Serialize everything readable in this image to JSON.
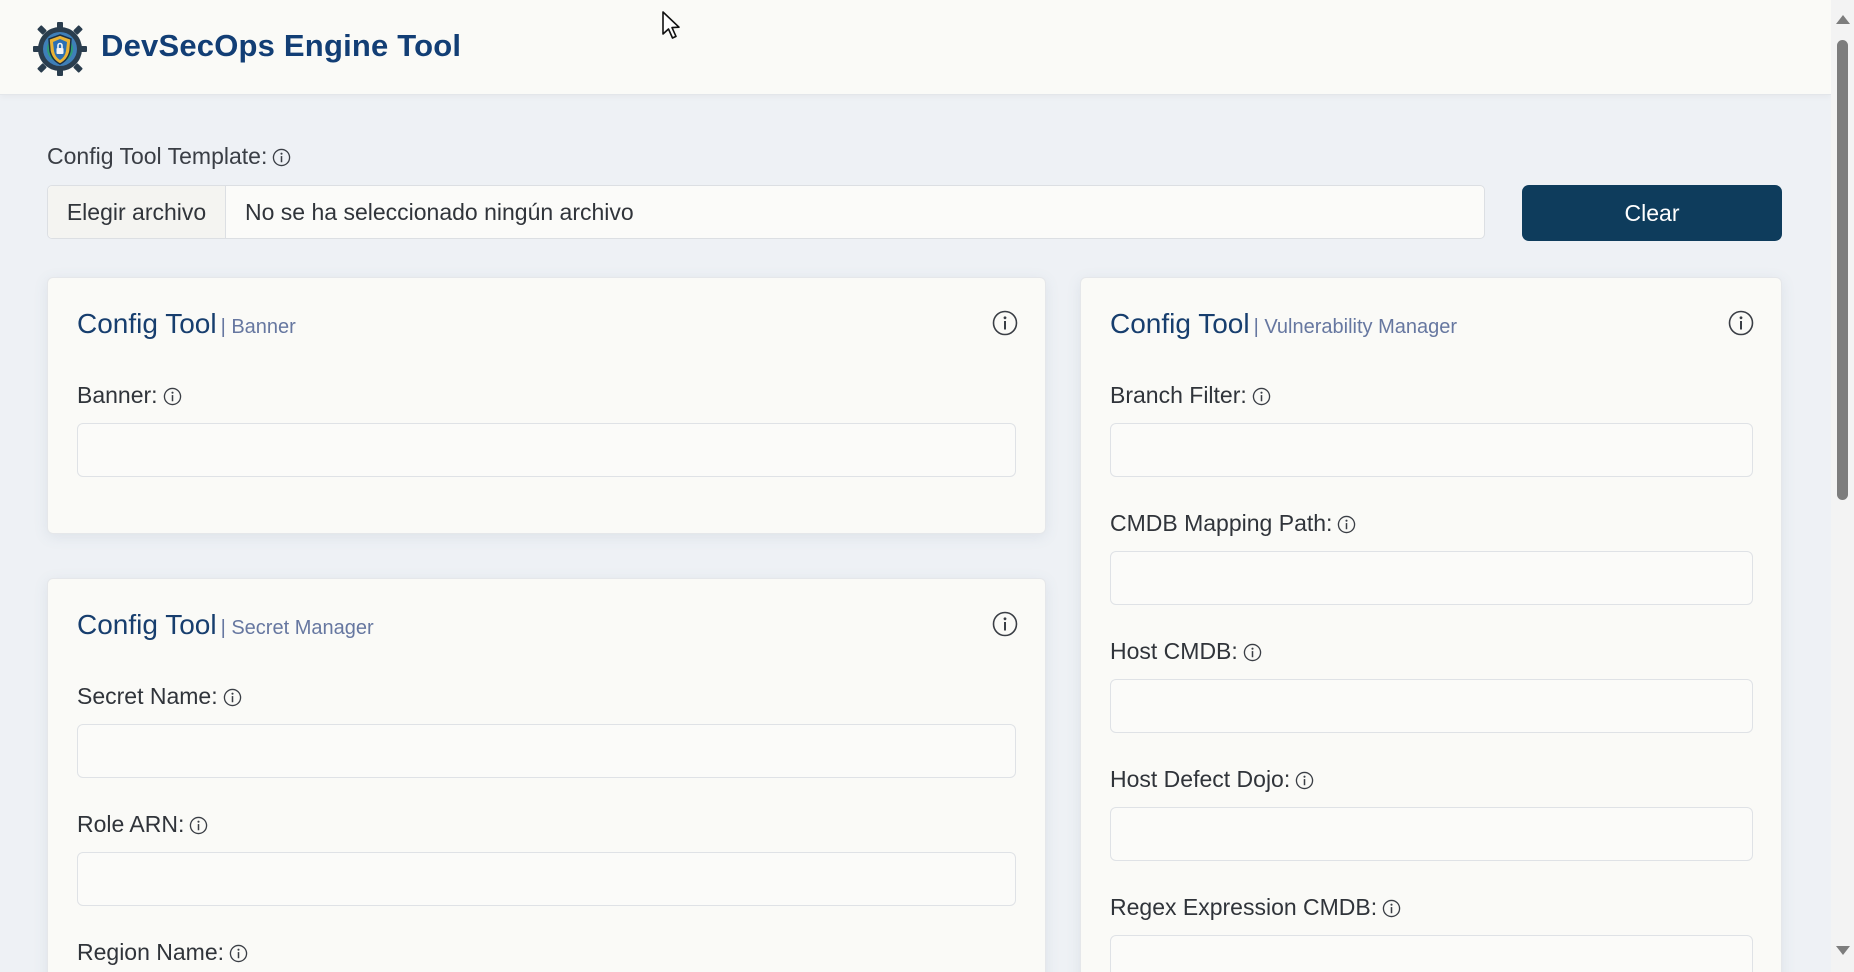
{
  "app": {
    "title": "DevSecOps Engine Tool"
  },
  "template": {
    "label": "Config Tool Template:",
    "file_button": "Elegir archivo",
    "file_status": "No se ha seleccionado ningún archivo",
    "clear_button": "Clear"
  },
  "cards": {
    "banner": {
      "title": "Config Tool",
      "subtitle": "| Banner",
      "fields": [
        {
          "label": "Banner:",
          "value": ""
        }
      ]
    },
    "secret_manager": {
      "title": "Config Tool",
      "subtitle": "| Secret Manager",
      "fields": [
        {
          "label": "Secret Name:",
          "value": ""
        },
        {
          "label": "Role ARN:",
          "value": ""
        },
        {
          "label": "Region Name:",
          "value": ""
        }
      ]
    },
    "vulnerability_manager": {
      "title": "Config Tool",
      "subtitle": "| Vulnerability Manager",
      "fields": [
        {
          "label": "Branch Filter:",
          "value": ""
        },
        {
          "label": "CMDB Mapping Path:",
          "value": ""
        },
        {
          "label": "Host CMDB:",
          "value": ""
        },
        {
          "label": "Host Defect Dojo:",
          "value": ""
        },
        {
          "label": "Regex Expression CMDB:",
          "value": ""
        }
      ]
    }
  },
  "icons": {
    "info": "info-circle-icon",
    "logo": "gear-shield-logo",
    "cursor": "mouse-pointer-icon"
  },
  "colors": {
    "title": "#123e75",
    "clear_button": "#0e3c5c",
    "subtitle": "#6677a0"
  }
}
